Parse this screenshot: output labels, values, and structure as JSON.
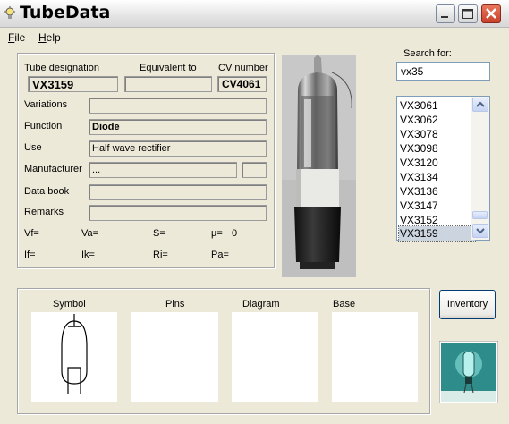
{
  "window": {
    "title": "TubeData"
  },
  "menu": {
    "file": "File",
    "help": "Help"
  },
  "details": {
    "tube_designation_label": "Tube designation",
    "tube_designation": "VX3159",
    "equivalent_label": "Equivalent to",
    "equivalent": "",
    "cv_label": "CV number",
    "cv_number": "CV4061",
    "variations_label": "Variations",
    "variations": "",
    "function_label": "Function",
    "function": "Diode",
    "use_label": "Use",
    "use": "Half wave rectifier",
    "manufacturer_label": "Manufacturer",
    "manufacturer": "...",
    "manufacturer_extra": "",
    "databook_label": "Data book",
    "databook": "",
    "remarks_label": "Remarks",
    "remarks": "",
    "params": {
      "vf": "Vf=",
      "va": "Va=",
      "s": "S=",
      "mu": "µ=",
      "mu_value": "0",
      "if": "If=",
      "ik": "Ik=",
      "ri": "Ri=",
      "pa": "Pa="
    }
  },
  "search": {
    "label": "Search for:",
    "value": "vx35",
    "results": [
      "VX3061",
      "VX3062",
      "VX3078",
      "VX3098",
      "VX3120",
      "VX3134",
      "VX3136",
      "VX3147",
      "VX3152",
      "VX3159"
    ],
    "selected_index": 9
  },
  "panels": {
    "symbol": "Symbol",
    "pins": "Pins",
    "diagram": "Diagram",
    "base": "Base"
  },
  "inventory_button": "Inventory",
  "icons": {
    "app": "lightbulb-icon",
    "minimize": "minimize-icon",
    "maximize": "maximize-icon",
    "close": "close-icon",
    "scroll_up": "scroll-up-arrow-icon",
    "scroll_down": "scroll-down-arrow-icon"
  },
  "colors": {
    "window_bg": "#ece9d8",
    "close_button": "#d9533a",
    "selection": "#ccd4e0"
  }
}
